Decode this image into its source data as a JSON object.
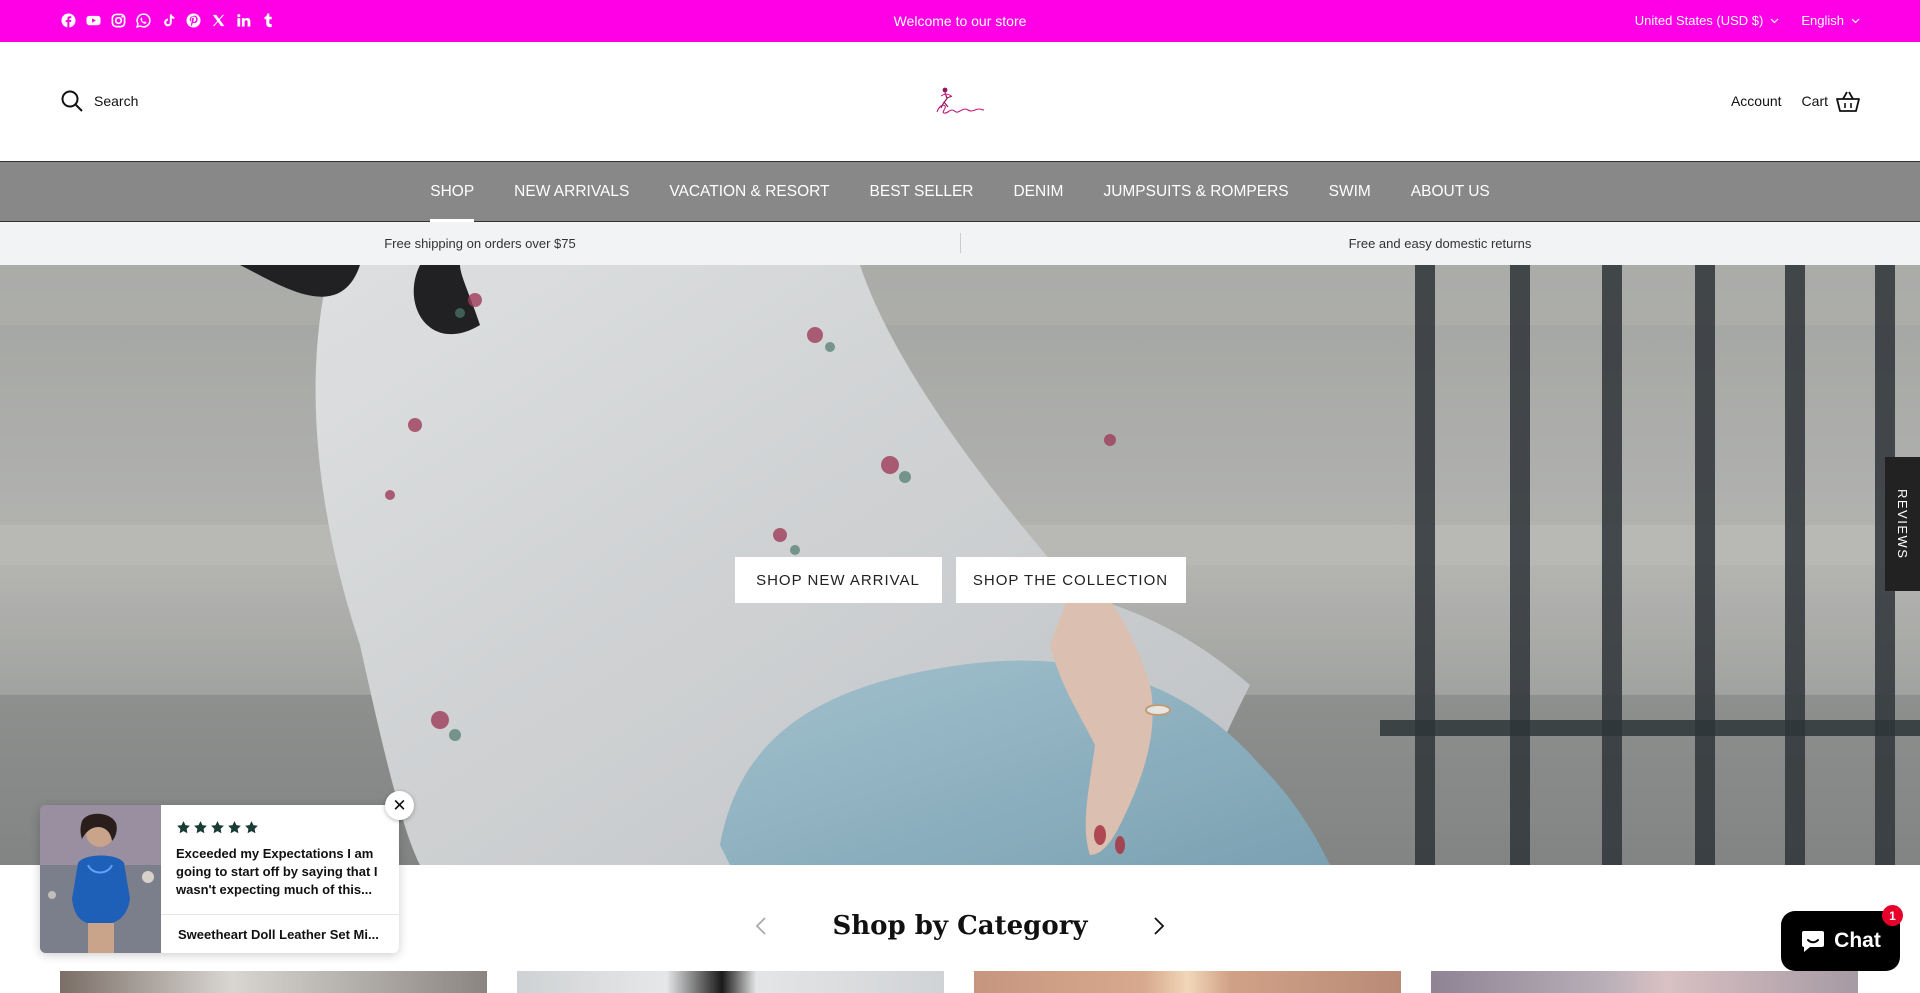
{
  "colors": {
    "topbar_bg": "#ff00e6",
    "nav_bg": "#888888",
    "usp_bg": "#f2f3f4",
    "chat_badge": "#e6002a"
  },
  "topbar": {
    "social_icons": [
      "facebook-icon",
      "youtube-icon",
      "instagram-icon",
      "whatsapp-icon",
      "tiktok-icon",
      "pinterest-icon",
      "x-icon",
      "linkedin-icon",
      "tumblr-icon"
    ],
    "welcome": "Welcome to our store",
    "currency": "United States (USD $)",
    "language": "English"
  },
  "header": {
    "search_label": "Search",
    "account_label": "Account",
    "cart_label": "Cart"
  },
  "nav": {
    "items": [
      {
        "label": "SHOP"
      },
      {
        "label": "NEW ARRIVALS"
      },
      {
        "label": "VACATION & RESORT"
      },
      {
        "label": "BEST SELLER"
      },
      {
        "label": "DENIM"
      },
      {
        "label": "JUMPSUITS & ROMPERS"
      },
      {
        "label": "SWIM"
      },
      {
        "label": "ABOUT US"
      }
    ]
  },
  "usp": {
    "left": "Free shipping on orders over $75",
    "right": "Free and easy domestic returns"
  },
  "hero": {
    "button_new_arrival": "SHOP NEW ARRIVAL",
    "button_collection": "SHOP THE COLLECTION"
  },
  "reviews_tab": "REVIEWS",
  "review_popup": {
    "rating": 5,
    "text": "Exceeded my Expectations I am going to start off by saying that I wasn't expecting much of this...",
    "product": "Sweetheart Doll Leather Set Mi..."
  },
  "category": {
    "title": "Shop by Category"
  },
  "chat": {
    "label": "Chat",
    "badge": "1"
  }
}
